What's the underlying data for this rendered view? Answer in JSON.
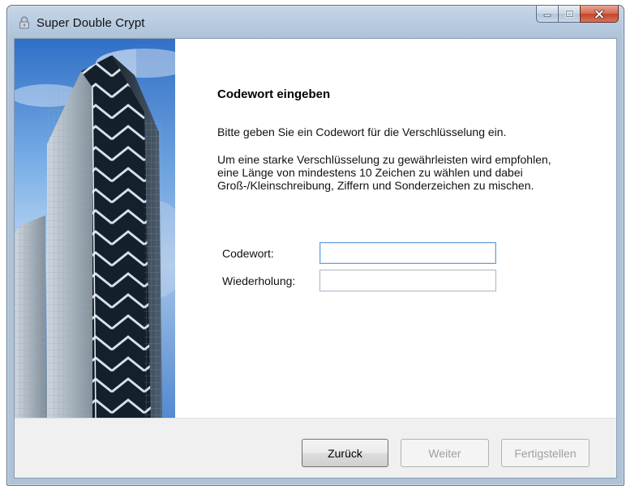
{
  "window": {
    "title": "Super Double Crypt"
  },
  "page": {
    "heading": "Codewort eingeben",
    "intro": "Bitte geben Sie ein Codewort für die Verschlüsselung ein.",
    "advice": "Um eine starke Verschlüsselung zu gewährleisten wird empfohlen, eine Länge von mindestens 10 Zeichen zu wählen und dabei Groß-/Kleinschreibung, Ziffern und Sonderzeichen zu mischen."
  },
  "form": {
    "codewort_label": "Codewort:",
    "codewort_value": "",
    "wiederholung_label": "Wiederholung:",
    "wiederholung_value": ""
  },
  "buttons": {
    "back_label": "Zurück",
    "next_label": "Weiter",
    "finish_label": "Fertigstellen"
  },
  "icons": {
    "app": "lock-icon",
    "minimize": "minimize-icon",
    "maximize": "maximize-icon",
    "close": "close-icon"
  }
}
